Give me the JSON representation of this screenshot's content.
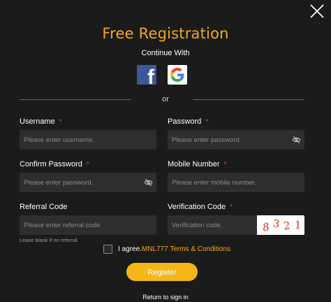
{
  "modal": {
    "title": "Free Registration",
    "subtitle": "Continue With",
    "divider_text": "or",
    "social": [
      {
        "name": "facebook",
        "icon": "facebook-icon",
        "color": "#3b5998"
      },
      {
        "name": "google",
        "icon": "google-icon"
      }
    ]
  },
  "form": {
    "username": {
      "label": "Username",
      "placeholder": "Please enter username."
    },
    "password": {
      "label": "Password",
      "placeholder": "Please enter password."
    },
    "confirm_password": {
      "label": "Confirm Password",
      "placeholder": "Please enter password."
    },
    "mobile_number": {
      "label": "Mobile Number",
      "placeholder": "Please enter mobile number."
    },
    "referral_code": {
      "label": "Referral Code",
      "placeholder": "Please enter referral code",
      "hint": "Leave blank if no referral."
    },
    "verification_code": {
      "label": "Verification Code",
      "placeholder": "Verification code.",
      "captcha": [
        "8",
        "3",
        "2",
        "1"
      ]
    },
    "required_mark": "*"
  },
  "agreement": {
    "prefix": "I agree.",
    "link": "MNL777 Terms & Conditions"
  },
  "register_label": "Register",
  "return_label": "Return to sign in",
  "colors": {
    "accent": "#f2a922",
    "button": "#f5b617",
    "background": "#1b1b1b",
    "input_bg": "#2e2e2e",
    "required": "#e2453c"
  }
}
